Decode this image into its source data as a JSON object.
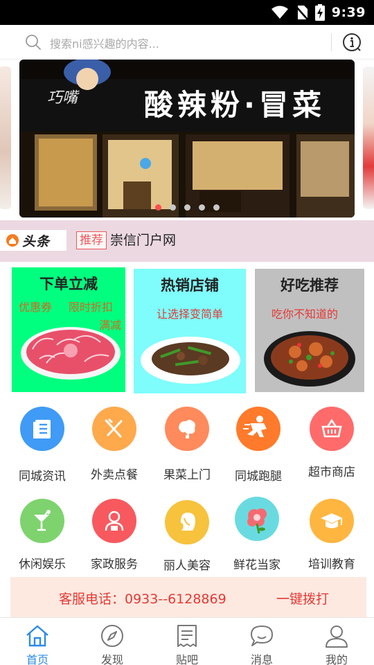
{
  "status_bar": {
    "time": "9:39"
  },
  "search": {
    "placeholder": "搜索ni感兴趣的内容..."
  },
  "banner": {
    "sign_text": "酸辣粉·冒菜",
    "brand_text": "巧嘴",
    "slide_count": 5,
    "active_slide": 1
  },
  "headline": {
    "logo_text": "头条",
    "tag": "推荐",
    "text": "崇信门户网"
  },
  "promos": [
    {
      "title": "下单立减",
      "subs": [
        "优惠券",
        "限时折扣",
        "满减"
      ],
      "bg": "#00ff7f"
    },
    {
      "title": "热销店铺",
      "subs": [
        "让选择变简单"
      ],
      "bg": "#7ffcfc"
    },
    {
      "title": "好吃推荐",
      "subs": [
        "吃你不知道的"
      ],
      "bg": "#c0c0c0"
    }
  ],
  "grid": [
    {
      "label": "同城资讯",
      "icon": "news-icon",
      "color": "#3f9bf5"
    },
    {
      "label": "外卖点餐",
      "icon": "fork-knife-icon",
      "color": "#ffa94d"
    },
    {
      "label": "果菜上门",
      "icon": "vegetable-icon",
      "color": "#ff8a5c"
    },
    {
      "label": "同城跑腿",
      "icon": "runner-icon",
      "color": "#ff7a2a"
    },
    {
      "label": "超市商店",
      "icon": "basket-icon",
      "color": "#ff6b6b"
    },
    {
      "label": "休闲娱乐",
      "icon": "cocktail-icon",
      "color": "#7ed36e"
    },
    {
      "label": "家政服务",
      "icon": "housekeeper-icon",
      "color": "#f7595f"
    },
    {
      "label": "丽人美容",
      "icon": "lady-icon",
      "color": "#f7c23c"
    },
    {
      "label": "鲜花当家",
      "icon": "flower-icon",
      "color": "#69dbe0"
    },
    {
      "label": "培训教育",
      "icon": "graduation-cap-icon",
      "color": "#ffb640"
    }
  ],
  "service": {
    "phone": "客服电话：0933--6128869",
    "call": "一键拨打"
  },
  "tabs": [
    {
      "label": "首页",
      "icon": "home-icon",
      "active": true
    },
    {
      "label": "发现",
      "icon": "compass-icon"
    },
    {
      "label": "贴吧",
      "icon": "forum-icon"
    },
    {
      "label": "消息",
      "icon": "message-icon"
    },
    {
      "label": "我的",
      "icon": "profile-icon"
    }
  ],
  "colors": {
    "accent": "#2c8be6",
    "danger": "#e53935",
    "headline_bg": "#ecd8e1"
  }
}
